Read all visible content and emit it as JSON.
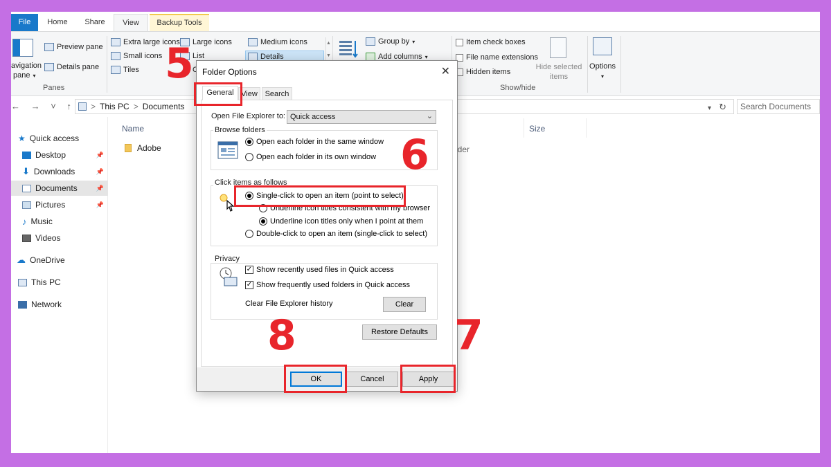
{
  "ribbon_tabs": {
    "file": "File",
    "home": "Home",
    "share": "Share",
    "view": "View",
    "backup": "Backup Tools"
  },
  "panes": {
    "navigation_pane": "avigation",
    "navigation_pane_2": "pane",
    "preview_pane": "Preview pane",
    "details_pane": "Details pane",
    "group_label": "Panes"
  },
  "layout": {
    "extra_large": "Extra large icons",
    "large": "Large icons",
    "medium": "Medium icons",
    "small": "Small icons",
    "list": "List",
    "details": "Details",
    "tiles": "Tiles",
    "content": "C"
  },
  "current_view": {
    "group_by": "Group by",
    "add_columns": "Add columns"
  },
  "show_hide": {
    "item_checkboxes": "Item check boxes",
    "file_name_extensions": "File name extensions",
    "hidden_items": "Hidden items",
    "hide_selected_1": "Hide selected",
    "hide_selected_2": "items",
    "options": "Options",
    "group_label": "Show/hide"
  },
  "address": {
    "nav_buttons": "← → ˅ ↑",
    "this_pc": "This PC",
    "sep": ">",
    "documents": "Documents",
    "search_placeholder": "Search Documents"
  },
  "nav": {
    "quick_access": "Quick access",
    "desktop": "Desktop",
    "downloads": "Downloads",
    "documents": "Documents",
    "pictures": "Pictures",
    "music": "Music",
    "videos": "Videos",
    "onedrive": "OneDrive",
    "this_pc": "This PC",
    "network": "Network"
  },
  "files": {
    "col_name": "Name",
    "col_size": "Size",
    "rows": [
      {
        "name": "Adobe",
        "type": "lder"
      }
    ]
  },
  "dialog": {
    "title": "Folder Options",
    "close": "✕",
    "tabs": {
      "general": "General",
      "view": "View",
      "search": "Search"
    },
    "open_label": "Open File Explorer to:",
    "open_value": "Quick access",
    "browse": {
      "label": "Browse folders",
      "same_window": "Open each folder in the same window",
      "own_window": "Open each folder in its own window"
    },
    "click": {
      "label": "Click items as follows",
      "single": "Single-click to open an item (point to select)",
      "underline_browser": "Underline icon titles consistent with my browser",
      "underline_point": "Underline icon titles only when I point at them",
      "double": "Double-click to open an item (single-click to select)"
    },
    "privacy": {
      "label": "Privacy",
      "recent_files": "Show recently used files in Quick access",
      "frequent_folders": "Show frequently used folders in Quick access",
      "clear_history": "Clear File Explorer history",
      "clear_button": "Clear"
    },
    "restore_defaults": "Restore Defaults",
    "ok": "OK",
    "cancel": "Cancel",
    "apply": "Apply"
  },
  "annotations": {
    "step5": "5",
    "step6": "6",
    "step7": "7",
    "step8": "8"
  },
  "colors": {
    "accent": "#1979ca",
    "annotation": "#e8252b",
    "background": "#c46fe4"
  }
}
